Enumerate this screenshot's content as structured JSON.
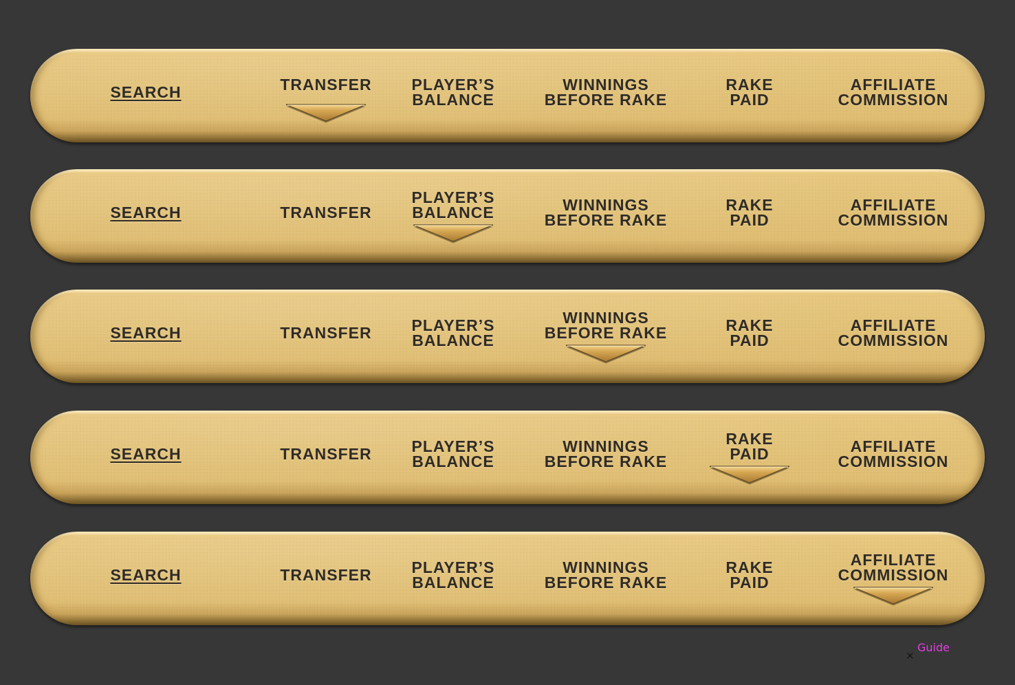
{
  "nav": {
    "search_label": "SEARCH",
    "transfer_label": "TRANSFER",
    "balance_label": "PLAYER’S\nBALANCE",
    "winnings_label": "WINNINGS\nBEFORE RAKE",
    "rake_label": "RAKE\nPAID",
    "affiliate_label": "AFFILIATE\nCOMMISSION"
  },
  "bars": [
    {
      "active": "transfer"
    },
    {
      "active": "balance"
    },
    {
      "active": "winnings"
    },
    {
      "active": "rake"
    },
    {
      "active": "affiliate"
    }
  ],
  "colors": {
    "background": "#373737",
    "bar_gold": "#e3c379",
    "text": "#2f2b26",
    "caret": "#c99b45",
    "guide_link": "#e13ee2"
  },
  "icons": {
    "active_indicator": "caret-down-icon",
    "close": "close-icon"
  },
  "guide": {
    "close_glyph": "×",
    "link_label": "Guide"
  }
}
